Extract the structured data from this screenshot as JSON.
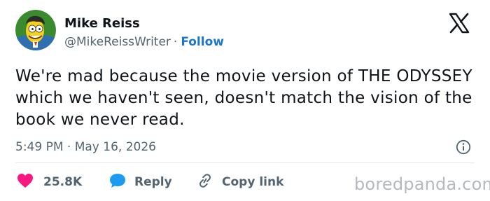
{
  "author": {
    "display_name": "Mike Reiss",
    "handle": "@MikeReissWriter",
    "separator": "·",
    "follow_label": "Follow"
  },
  "tweet": {
    "text": "We're mad because the movie version of THE ODYSSEY which we haven't seen, doesn't match the vision of the book we never read.",
    "timestamp": "5:49 PM · May 16, 2026"
  },
  "actions": {
    "like_count": "25.8K",
    "reply_label": "Reply",
    "copy_link_label": "Copy link"
  },
  "watermark": "boredpanda.com",
  "icons": {
    "brand": "x-logo-icon",
    "info": "info-icon",
    "like": "heart-icon",
    "reply": "speech-bubble-icon",
    "copy": "link-icon"
  },
  "colors": {
    "text": "#0f1419",
    "secondary": "#536471",
    "follow": "#1d77c9",
    "like": "#f91880",
    "reply": "#1d9bf0",
    "watermark": "#b5b8bc"
  }
}
